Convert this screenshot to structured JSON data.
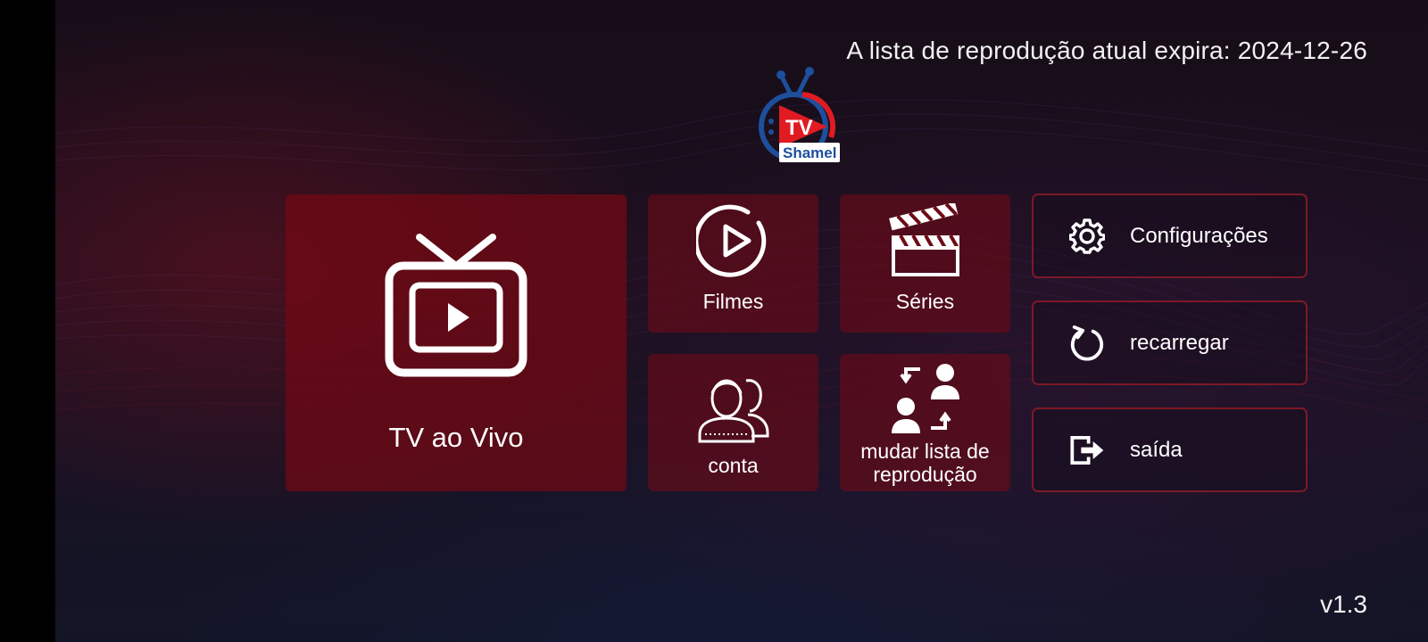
{
  "header": {
    "expiry_text": "A lista de reprodução atual expira: 2024-12-26"
  },
  "logo": {
    "line1": "TV",
    "line2": "Shamel"
  },
  "tiles": {
    "live": "TV ao Vivo",
    "movies": "Filmes",
    "series": "Séries",
    "account": "conta",
    "switch_playlist_line1": "mudar lista de",
    "switch_playlist_line2": "reprodução"
  },
  "menu": {
    "settings": "Configurações",
    "reload": "recarregar",
    "exit": "saída"
  },
  "footer": {
    "version": "v1.3"
  },
  "colors": {
    "tile_red": "#6e0a16",
    "border_red": "#8c1c28",
    "logo_blue": "#1d4f9c",
    "logo_red": "#e01b22"
  }
}
